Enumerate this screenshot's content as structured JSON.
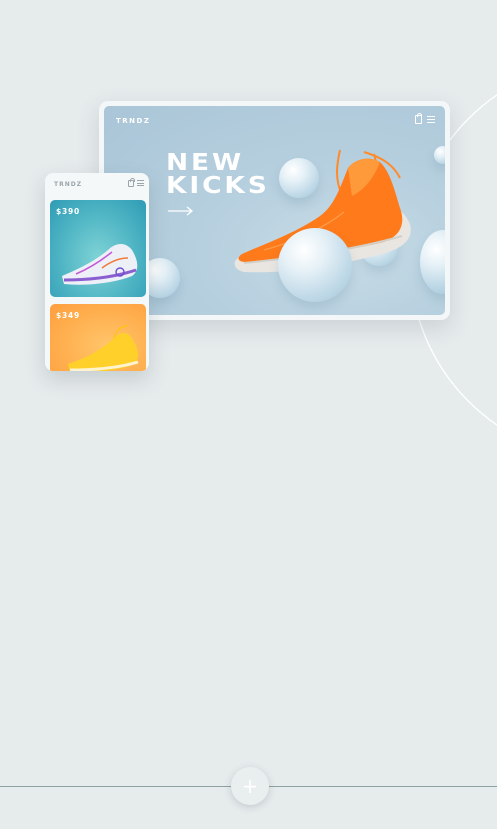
{
  "brand": {
    "name": "TRNDZ"
  },
  "hero": {
    "title_line1": "NEW",
    "title_line2": "KICKS"
  },
  "mobile": {
    "products": [
      {
        "price": "$390"
      },
      {
        "price": "$349"
      }
    ]
  },
  "colors": {
    "background": "#e6ebec",
    "shoe_orange": "#ff7a1a",
    "card_teal": "#4fb5c4",
    "card_yellow": "#ffae4d"
  },
  "icons": {
    "bag": "shopping-bag-icon",
    "menu": "hamburger-menu-icon",
    "arrow": "arrow-right-icon",
    "add": "plus-icon"
  },
  "add_button": {
    "glyph": "+"
  }
}
